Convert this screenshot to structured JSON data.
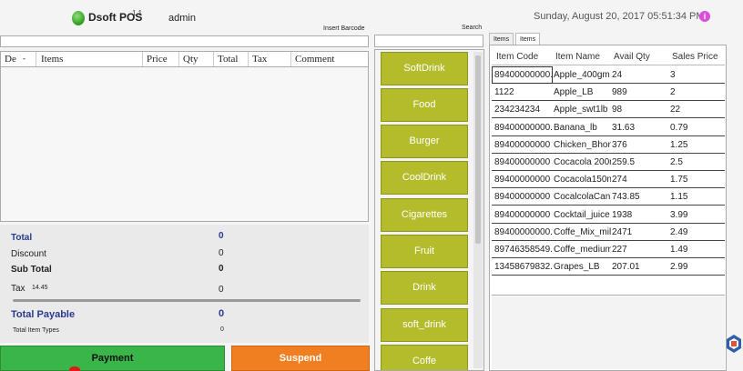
{
  "header": {
    "app_name": "Dsoft POS",
    "version": "1.1",
    "user": "admin",
    "datetime": "Sunday,  August 20,  2017  05:51:34  PM",
    "info_icon": "i"
  },
  "barcode": {
    "label": "Insert Barcode",
    "value": ""
  },
  "search": {
    "label": "Search",
    "value": ""
  },
  "cart": {
    "columns": [
      "De",
      "Items",
      "Price",
      "Qty",
      "Total",
      "Tax",
      "Comment"
    ]
  },
  "totals": {
    "total_label": "Total",
    "total_value": "0",
    "discount_label": "Discount",
    "discount_value": "0",
    "subtotal_label": "Sub Total",
    "subtotal_value": "0",
    "tax_label": "Tax",
    "tax_rate": "14.45",
    "tax_value": "0",
    "payable_label": "Total Payable",
    "payable_value": "0",
    "item_types_label": "Total Item Types",
    "item_types_value": "0"
  },
  "actions": {
    "payment": "Payment",
    "suspend": "Suspend"
  },
  "categories": [
    "SoftDrink",
    "Food",
    "Burger",
    "CoolDrink",
    "Cigarettes",
    "Fruit",
    "Drink",
    "soft_drink",
    "Coffe"
  ],
  "tabs": [
    "Items",
    "Items List"
  ],
  "items_grid": {
    "columns": [
      "Item Code",
      "Item Name",
      "Avail Qty",
      "Sales Price"
    ],
    "rows": [
      [
        "89400000000.",
        "Apple_400gm",
        "24",
        "3"
      ],
      [
        "1122",
        "Apple_LB",
        "989",
        "2"
      ],
      [
        "234234234",
        "Apple_swt1lb",
        "98",
        "22"
      ],
      [
        "89400000000.",
        "Banana_lb",
        "31.63",
        "0.79"
      ],
      [
        "89400000000",
        "Chicken_Bhon",
        "376",
        "1.25"
      ],
      [
        "89400000000",
        "Cocacola 200r",
        "259.5",
        "2.5"
      ],
      [
        "89400000000",
        "Cocacola150n",
        "274",
        "1.75"
      ],
      [
        "89400000000",
        "CocalcolaCan",
        "743.85",
        "1.15"
      ],
      [
        "89400000000",
        "Cocktail_juice",
        "1938",
        "3.99"
      ],
      [
        "89400000000.",
        "Coffe_Mix_mil",
        "2471",
        "2.49"
      ],
      [
        "89746358549.",
        "Coffe_medium",
        "227",
        "1.49"
      ],
      [
        "13458679832.",
        "Grapes_LB",
        "207.01",
        "2.99"
      ]
    ]
  },
  "colors": {
    "payment": "#39b54a",
    "suspend": "#f07f22",
    "category": "#b4bc2c",
    "accent_blue": "#2b3a8f"
  }
}
